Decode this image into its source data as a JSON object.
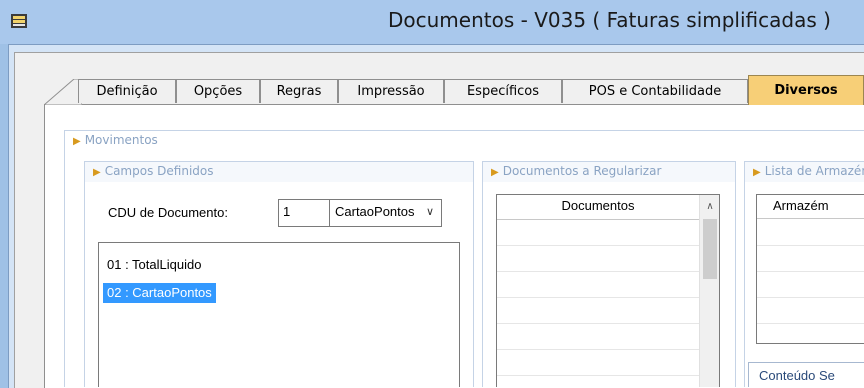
{
  "window": {
    "title": "Documentos - V035 ( Faturas simplificadas )"
  },
  "tabs": [
    {
      "label": "Definição"
    },
    {
      "label": "Opções"
    },
    {
      "label": "Regras"
    },
    {
      "label": "Impressão"
    },
    {
      "label": "Específicos"
    },
    {
      "label": "POS e Contabilidade"
    },
    {
      "label": "Diversos"
    }
  ],
  "movimentos": {
    "title": "Movimentos",
    "campos": {
      "title": "Campos Definidos",
      "cdu_label": "CDU de Documento:",
      "cdu_value": "1",
      "cdu_combo": "CartaoPontos",
      "items": [
        {
          "label": "01 : TotalLiquido"
        },
        {
          "label": "02 : CartaoPontos"
        }
      ]
    },
    "regularizar": {
      "title": "Documentos a Regularizar",
      "column": "Documentos"
    },
    "armazens": {
      "title": "Lista de Armazéns",
      "column": "Armazém"
    },
    "conteudo": {
      "title": "Conteúdo Se"
    }
  },
  "colors": {
    "accent_tab": "#f7cf77",
    "selection": "#3399ff"
  }
}
